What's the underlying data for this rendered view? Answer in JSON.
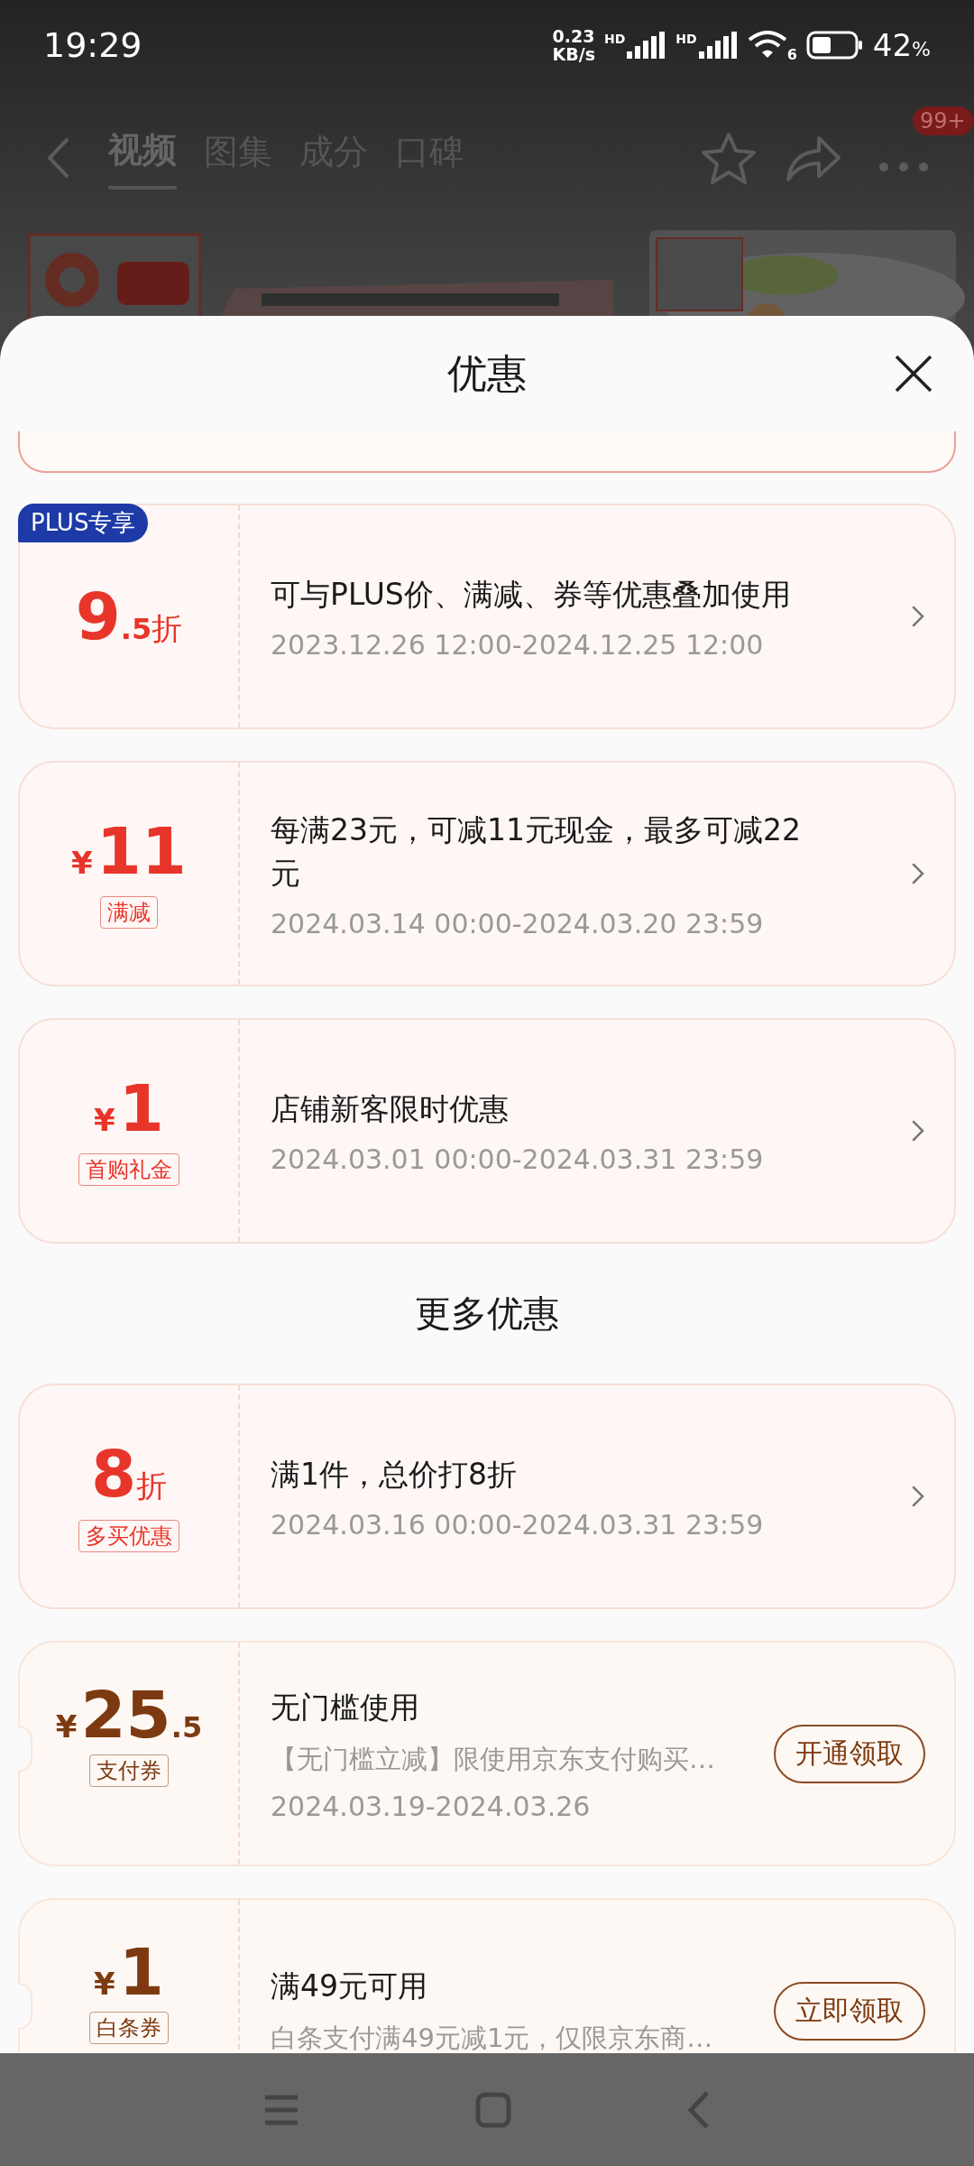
{
  "status_bar": {
    "time": "19:29",
    "net_speed": "0.23",
    "net_unit": "KB/s",
    "sim_labels": [
      "HD",
      "HD"
    ],
    "wifi_label": "6",
    "battery_percent": "42",
    "battery_unit": "%"
  },
  "background_page": {
    "tabs": [
      {
        "label": "视频",
        "selected": true
      },
      {
        "label": "图集",
        "selected": false
      },
      {
        "label": "成分",
        "selected": false
      },
      {
        "label": "口碑",
        "selected": false
      }
    ],
    "badge": "99+"
  },
  "sheet": {
    "title": "优惠"
  },
  "offers": [
    {
      "kind": "promo",
      "badge": "PLUS专享",
      "value": {
        "main": "9",
        "fraction": ".5",
        "unit": "折"
      },
      "title": "可与PLUS价、满减、券等优惠叠加使用",
      "dates": "2023.12.26 12:00-2024.12.25 12:00"
    },
    {
      "kind": "promo",
      "value": {
        "currency": "¥",
        "main": "11"
      },
      "tag": "满减",
      "title": "每满23元，可减11元现金，最多可减22元",
      "dates": "2024.03.14 00:00-2024.03.20 23:59"
    },
    {
      "kind": "promo",
      "value": {
        "currency": "¥",
        "main": "1"
      },
      "tag": "首购礼金",
      "title": "店铺新客限时优惠",
      "dates": "2024.03.01 00:00-2024.03.31 23:59"
    }
  ],
  "more_heading": "更多优惠",
  "more_offers": [
    {
      "kind": "promo",
      "value": {
        "main": "8",
        "unit": "折"
      },
      "tag": "多买优惠",
      "title": "满1件，总价打8折",
      "dates": "2024.03.16 00:00-2024.03.31 23:59"
    },
    {
      "kind": "coupon",
      "value": {
        "currency": "¥",
        "main": "25",
        "fraction": ".5"
      },
      "tag": "支付券",
      "title": "无门槛使用",
      "desc": "【无门槛立减】限使用京东支付购买…",
      "dates": "2024.03.19-2024.03.26",
      "action": "开通领取"
    },
    {
      "kind": "coupon",
      "value": {
        "currency": "¥",
        "main": "1"
      },
      "tag": "白条券",
      "title": "满49元可用",
      "desc": "白条支付满49元减1元，仅限京东商…",
      "action": "立即领取"
    }
  ]
}
